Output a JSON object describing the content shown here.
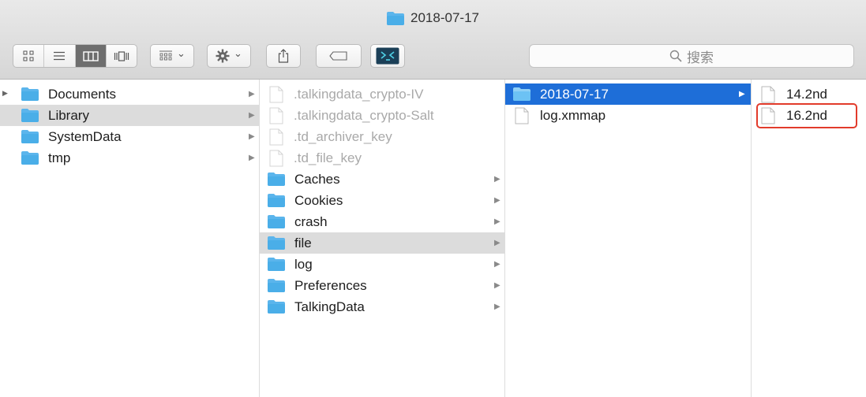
{
  "window": {
    "title": "2018-07-17"
  },
  "toolbar": {
    "view_modes": [
      "icon-view",
      "list-view",
      "column-view",
      "cover-flow-view"
    ],
    "active_view": "column-view",
    "arrange_chevron": "⌄",
    "action_chevron": "⌄",
    "search_placeholder": "搜索"
  },
  "columns": [
    {
      "items": [
        {
          "label": "Documents",
          "type": "folder",
          "arrow": true
        },
        {
          "label": "Library",
          "type": "folder",
          "arrow": true,
          "selected": true
        },
        {
          "label": "SystemData",
          "type": "folder",
          "arrow": true
        },
        {
          "label": "tmp",
          "type": "folder",
          "arrow": true
        }
      ]
    },
    {
      "items": [
        {
          "label": ".talkingdata_crypto-IV",
          "type": "file",
          "dim": true
        },
        {
          "label": ".talkingdata_crypto-Salt",
          "type": "file",
          "dim": true
        },
        {
          "label": ".td_archiver_key",
          "type": "file",
          "dim": true
        },
        {
          "label": ".td_file_key",
          "type": "file",
          "dim": true
        },
        {
          "label": "Caches",
          "type": "folder",
          "arrow": true
        },
        {
          "label": "Cookies",
          "type": "folder",
          "arrow": true
        },
        {
          "label": "crash",
          "type": "folder",
          "arrow": true
        },
        {
          "label": "file",
          "type": "folder",
          "arrow": true,
          "selected": true
        },
        {
          "label": "log",
          "type": "folder",
          "arrow": true
        },
        {
          "label": "Preferences",
          "type": "folder",
          "arrow": true
        },
        {
          "label": "TalkingData",
          "type": "folder",
          "arrow": true
        }
      ]
    },
    {
      "items": [
        {
          "label": "2018-07-17",
          "type": "folder",
          "arrow": true,
          "active": true
        },
        {
          "label": "log.xmmap",
          "type": "file"
        }
      ]
    },
    {
      "items": [
        {
          "label": "14.2nd",
          "type": "file"
        },
        {
          "label": "16.2nd",
          "type": "file",
          "highlighted": true
        }
      ]
    }
  ],
  "colors": {
    "folder": "#4aaee8",
    "selection_blue": "#1e6ed8",
    "selection_gray": "#dcdcdc",
    "highlight_box": "#e23b2b"
  }
}
